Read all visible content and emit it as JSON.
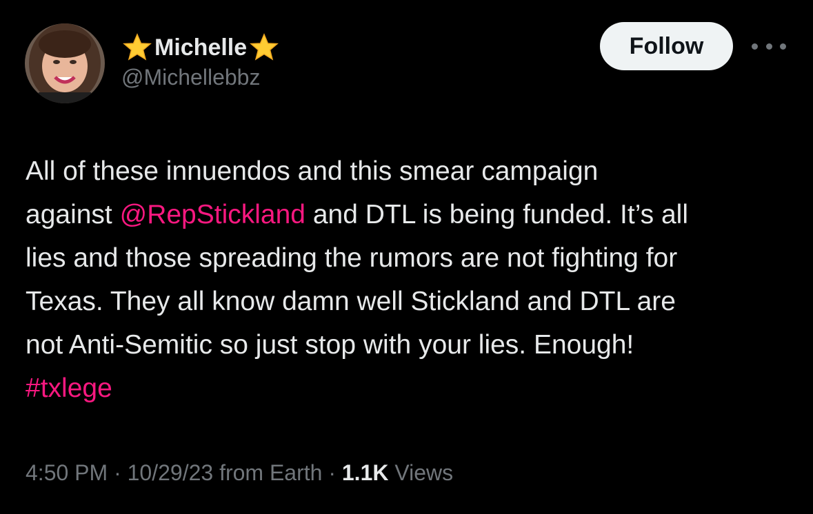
{
  "author": {
    "display_name": "Michelle",
    "handle": "@Michellebbz",
    "avatar_icon": "profile-photo-avatar",
    "name_decoration_icon": "star-emoji-icon"
  },
  "follow_button": {
    "label": "Follow"
  },
  "more_menu": {
    "icon": "more-horizontal-icon"
  },
  "tweet": {
    "lines": {
      "l1": "All of these innuendos and this smear campaign",
      "l2_before": "against ",
      "l2_mention": "@RepStickland",
      "l2_after": " and DTL is being funded. It’s all",
      "l3": "lies and those spreading the rumors are not fighting for",
      "l4": "Texas. They all know damn well Stickland and DTL are",
      "l5": "not Anti-Semitic so just stop with your lies. Enough!",
      "hashtag": "#txlege"
    }
  },
  "meta": {
    "time": "4:50 PM",
    "sep1": " · ",
    "date": "10/29/23",
    "source": " from Earth",
    "sep2": " · ",
    "views_count": "1.1K",
    "views_label": " Views"
  },
  "colors": {
    "background": "#000000",
    "text_primary": "#e7e9ea",
    "text_secondary": "#71767b",
    "link": "#f91880",
    "button_bg": "#eff3f4",
    "button_text": "#0f1419",
    "star": "#ffcc33"
  }
}
